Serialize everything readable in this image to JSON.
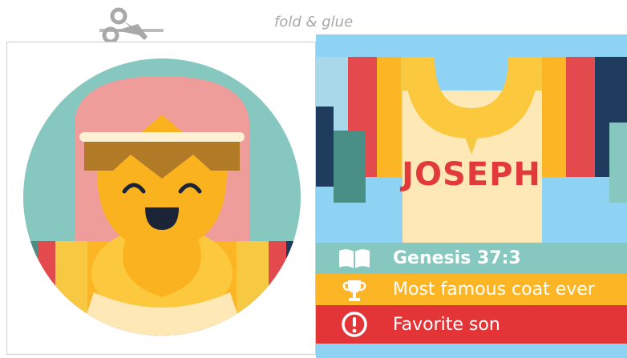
{
  "header": {
    "icon": "scissors-icon",
    "fold_label": "fold & glue"
  },
  "card": {
    "name": "JOSEPH",
    "facts": [
      {
        "icon": "open-book-icon",
        "text": "Genesis 37:3"
      },
      {
        "icon": "trophy-icon",
        "text": "Most famous coat ever"
      },
      {
        "icon": "exclamation-icon",
        "text": "Favorite son"
      }
    ]
  },
  "colors": {
    "teal": "#86c7bf",
    "yellow": "#fcb524",
    "red": "#e33537",
    "sky": "#8ed3f3",
    "skin": "#fbb21f",
    "headcloth": "#ee9d9b",
    "shirt": "#fde8b6"
  }
}
